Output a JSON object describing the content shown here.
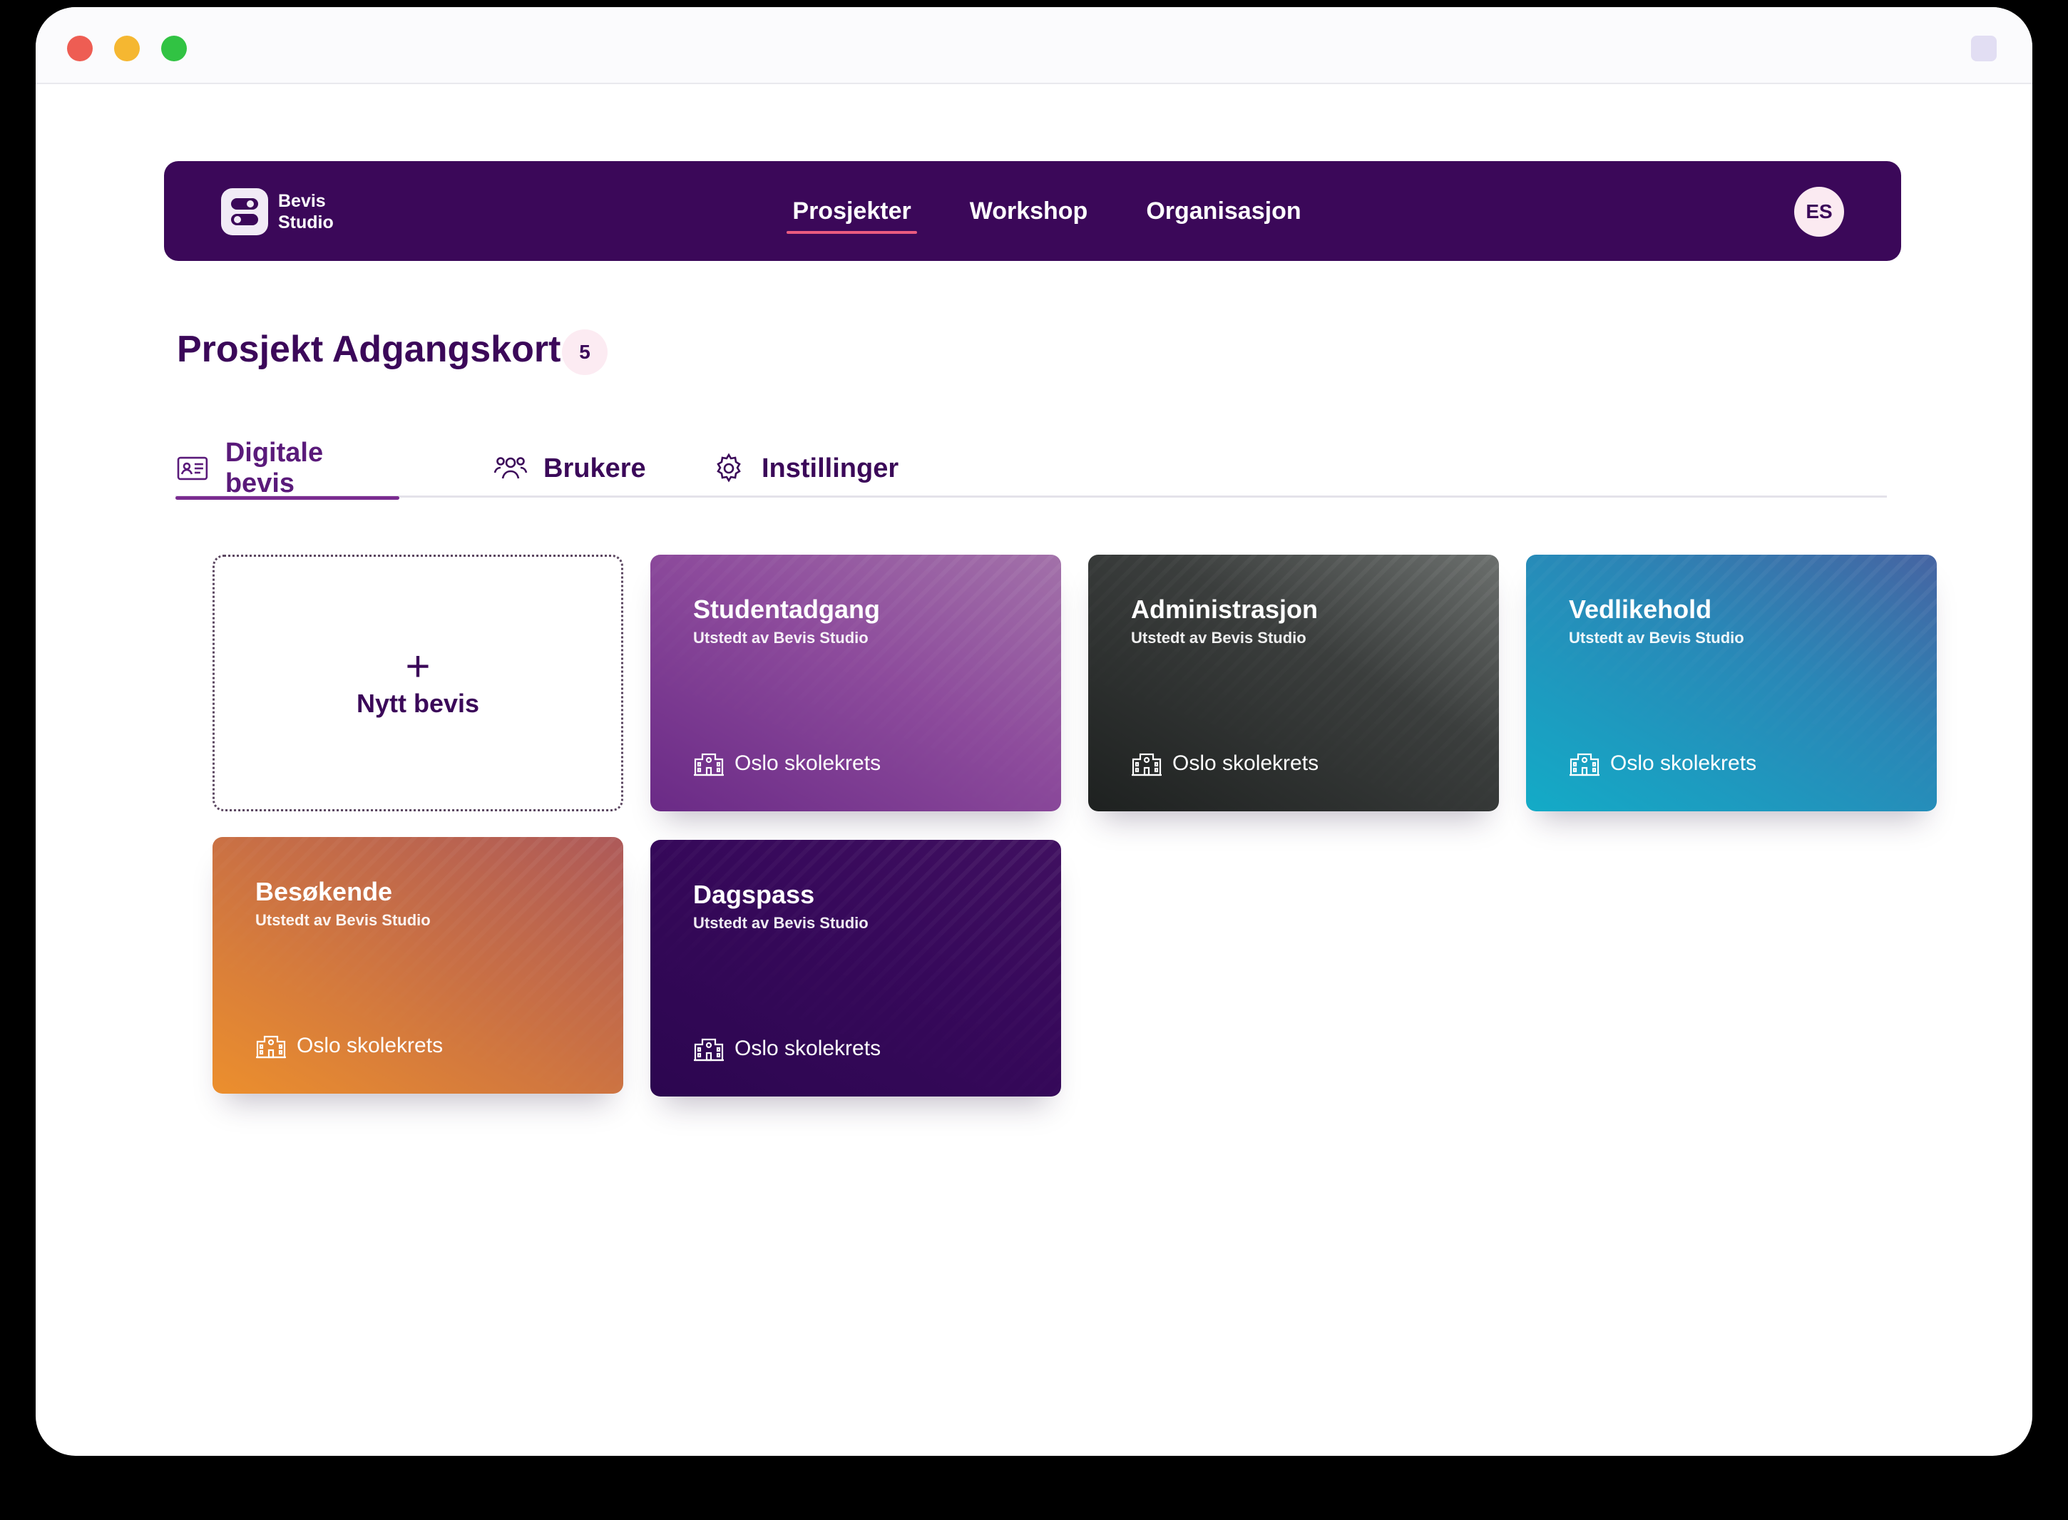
{
  "app": {
    "logo_line1": "Bevis",
    "logo_line2": "Studio"
  },
  "nav": {
    "items": [
      {
        "label": "Prosjekter",
        "active": true
      },
      {
        "label": "Workshop",
        "active": false
      },
      {
        "label": "Organisasjon",
        "active": false
      }
    ],
    "avatar_initials": "ES"
  },
  "page": {
    "title": "Prosjekt Adgangskort",
    "count": "5"
  },
  "tabs": [
    {
      "label": "Digitale bevis",
      "icon": "id-card-icon",
      "active": true
    },
    {
      "label": "Brukere",
      "icon": "users-icon",
      "active": false
    },
    {
      "label": "Instillinger",
      "icon": "gear-icon",
      "active": false
    }
  ],
  "new_card": {
    "plus": "+",
    "label": "Nytt bevis"
  },
  "cards": [
    {
      "title": "Studentadgang",
      "subtitle": "Utstedt av Bevis Studio",
      "org": "Oslo skolekrets",
      "color": "#8d4b9c"
    },
    {
      "title": "Administrasjon",
      "subtitle": "Utstedt av Bevis Studio",
      "org": "Oslo skolekrets",
      "color": "#3b3e3d"
    },
    {
      "title": "Vedlikehold",
      "subtitle": "Utstedt av Bevis Studio",
      "org": "Oslo skolekrets",
      "color": "#2a86b6"
    },
    {
      "title": "Besøkende",
      "subtitle": "Utstedt av Bevis Studio",
      "org": "Oslo skolekrets",
      "color": "#c86f45"
    },
    {
      "title": "Dagspass",
      "subtitle": "Utstedt av Bevis Studio",
      "org": "Oslo skolekrets",
      "color": "#37095b"
    }
  ],
  "colors": {
    "brand": "#3b0859",
    "nav_active_underline": "#ea5b7f"
  }
}
